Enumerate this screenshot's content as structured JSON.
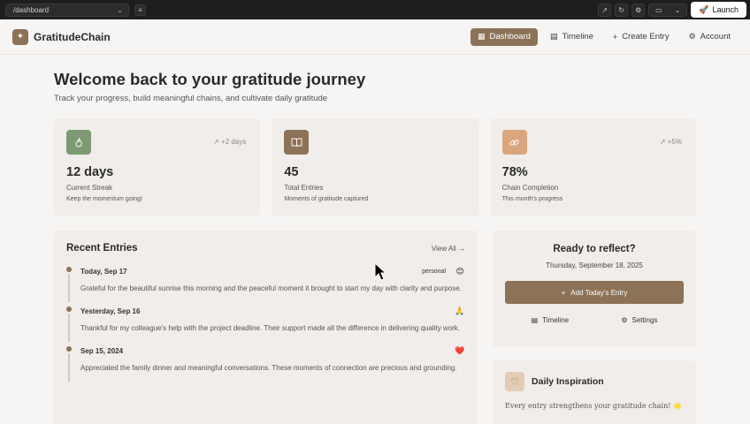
{
  "browser": {
    "url": "/dashboard",
    "launch_label": "Launch"
  },
  "brand": {
    "name": "GratitudeChain",
    "logo_glyph": "✦"
  },
  "nav": {
    "items": [
      {
        "label": "Dashboard",
        "icon": "grid-icon",
        "glyph": "▦"
      },
      {
        "label": "Timeline",
        "icon": "calendar-icon",
        "glyph": "▤"
      },
      {
        "label": "Create Entry",
        "icon": "plus-icon",
        "glyph": "+"
      },
      {
        "label": "Account",
        "icon": "gear-icon",
        "glyph": "⚙"
      }
    ]
  },
  "hero": {
    "title": "Welcome back to your gratitude journey",
    "subtitle": "Track your progress, build meaningful chains, and cultivate daily gratitude"
  },
  "stats": [
    {
      "value": "12 days",
      "label": "Current Streak",
      "note": "Keep the momentum going!",
      "trend": "↗ +2 days",
      "icon": "flame-icon",
      "glyph": "🔥",
      "color": "#7d9a72"
    },
    {
      "value": "45",
      "label": "Total Entries",
      "note": "Moments of gratitude captured",
      "trend": "",
      "icon": "book-icon",
      "glyph": "▥",
      "color": "#8c7257"
    },
    {
      "value": "78%",
      "label": "Chain Completion",
      "note": "This month's progress",
      "trend": "↗ +5%",
      "icon": "link-icon",
      "glyph": "⛓",
      "color": "#d9a67e"
    }
  ],
  "recent": {
    "title": "Recent Entries",
    "view_all": "View All →",
    "entries": [
      {
        "date": "Today, Sep 17",
        "tag": "personal",
        "emoji": "😊",
        "text": "Grateful for the beautiful sunrise this morning and the peaceful moment it brought to start my day with clarity and purpose."
      },
      {
        "date": "Yesterday, Sep 16",
        "tag": "",
        "emoji": "🙏",
        "text": "Thankful for my colleague's help with the project deadline. Their support made all the difference in delivering quality work."
      },
      {
        "date": "Sep 15, 2024",
        "tag": "",
        "emoji": "❤️",
        "text": "Appreciated the family dinner and meaningful conversations. These moments of connection are precious and grounding."
      }
    ]
  },
  "reflect": {
    "title": "Ready to reflect?",
    "date": "Thursday, September 18, 2025",
    "add_label": "Add Today's Entry",
    "timeline_label": "Timeline",
    "settings_label": "Settings"
  },
  "inspiration": {
    "title": "Daily Inspiration",
    "text": "Every entry strengthens your gratitude chain! 🌟"
  }
}
